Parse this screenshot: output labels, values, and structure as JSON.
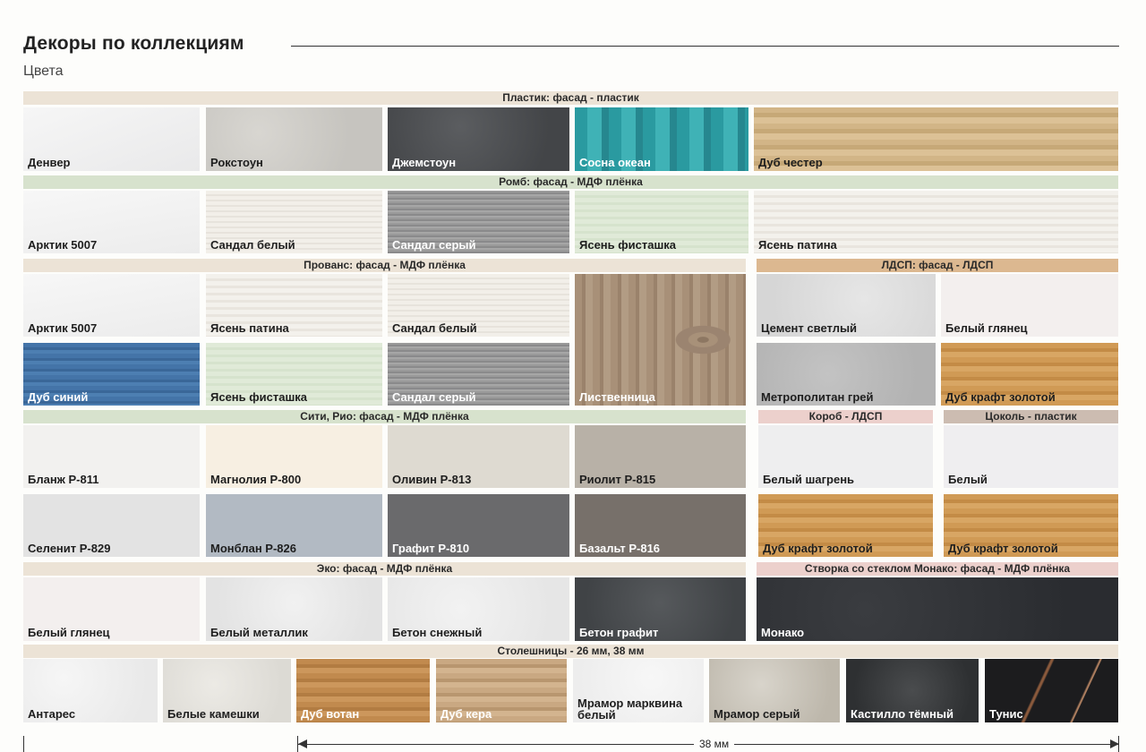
{
  "header": {
    "title": "Декоры по коллекциям",
    "subtitle": "Цвета"
  },
  "bands": {
    "plastic": "Пластик: фасад - пластик",
    "romb": "Ромб: фасад - МДФ плёнка",
    "provans": "Прованс: фасад - МДФ плёнка",
    "ldsp": "ЛДСП: фасад - ЛДСП",
    "siti": "Сити, Рио: фасад - МДФ плёнка",
    "korob": "Короб - ЛДСП",
    "tsokol": "Цоколь - пластик",
    "eko": "Эко: фасад - МДФ плёнка",
    "stvorka": "Створка со стеклом Монако: фасад - МДФ плёнка",
    "stoleshnitsy": "Столешницы - 26 мм, 38 мм"
  },
  "swatches": {
    "denver": "Денвер",
    "rokstoun": "Рокстоун",
    "dzhemstoun": "Джемстоун",
    "sosna_okean": "Сосна океан",
    "dub_chester": "Дуб честер",
    "arktik_romb": "Арктик 5007",
    "sandal_belyi_romb": "Сандал белый",
    "sandal_seryi_romb": "Сандал серый",
    "yasen_fistashka_romb": "Ясень фисташка",
    "yasen_patina_romb": "Ясень патина",
    "arktik_provans": "Арктик 5007",
    "yasen_patina_provans": "Ясень патина",
    "sandal_belyi_provans": "Сандал белый",
    "listvennitsa": "Лиственница",
    "dub_sinii": "Дуб синий",
    "yasen_fistashka_provans": "Ясень фисташка",
    "sandal_seryi_provans": "Сандал серый",
    "tsement_svetlyi": "Цемент светлый",
    "belyi_glyanets_ldsp": "Белый глянец",
    "metropolitan_grei": "Метрополитан грей",
    "dub_kraft_ldsp": "Дуб крафт золотой",
    "blanzh": "Бланж Р-811",
    "magnoliya": "Магнолия Р-800",
    "olivin": "Оливин Р-813",
    "riolit": "Риолит Р-815",
    "selenit": "Селенит Р-829",
    "monblan": "Монблан Р-826",
    "grafit": "Графит Р-810",
    "bazalt": "Базальт Р-816",
    "belyi_shagren": "Белый шагрень",
    "dub_kraft_korob": "Дуб крафт золотой",
    "belyi_tsokol": "Белый",
    "dub_kraft_tsokol": "Дуб крафт золотой",
    "belyi_glyanets_eko": "Белый глянец",
    "belyi_metallik": "Белый металлик",
    "beton_snezhnyi": "Бетон снежный",
    "beton_grafit": "Бетон графит",
    "monako": "Монако",
    "antares": "Антарес",
    "belye_kameshki": "Белые камешки",
    "dub_votan": "Дуб вотан",
    "dub_kera": "Дуб кера",
    "mramor_markvina": "Мрамор марквина белый",
    "mramor_seryi": "Мрамор серый",
    "kastillo": "Кастилло тёмный",
    "tunis": "Тунис"
  },
  "dimension": {
    "label": "38 мм"
  },
  "colors": {
    "band_beige": "#ece3d6",
    "band_green": "#d7e2cd",
    "band_tan": "#dcb890",
    "band_pink": "#ecd0cc",
    "band_taupe": "#ccbcb1"
  }
}
